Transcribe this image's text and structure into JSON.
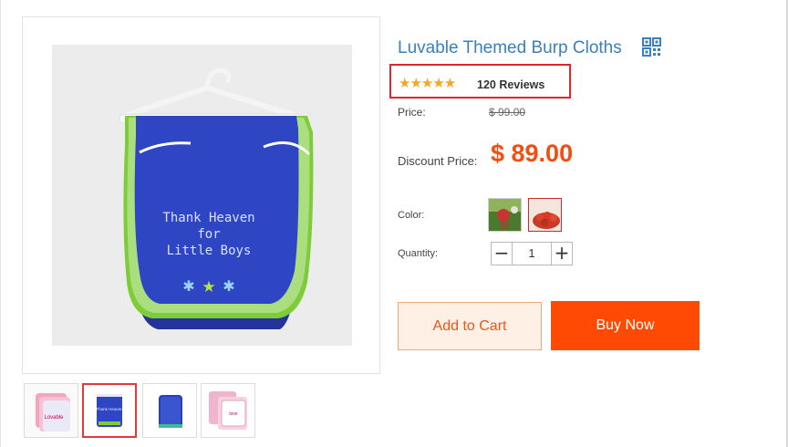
{
  "product": {
    "title": "Luvable Themed Burp Cloths",
    "qr_icon": "qr-code-icon",
    "rating": {
      "stars": "★★★★★",
      "star_count": 5,
      "reviews_label": "120 Reviews"
    },
    "price_label": "Price:",
    "price_original": "$ 99.00",
    "discount_label": "Discount Price:",
    "discount_price": "$ 89.00",
    "color_label": "Color:",
    "quantity_label": "Quantity:",
    "quantity_value": "1",
    "minus_symbol": "−",
    "plus_symbol": "+",
    "add_to_cart_label": "Add to Cart",
    "buy_now_label": "Buy Now",
    "main_image_text": [
      "Thank Heaven",
      "for",
      "Little Boys"
    ]
  },
  "colors": {
    "title": "#3a7fc1",
    "discount": "#f34d0f",
    "buy_now": "#ff4a04",
    "highlight_border": "#e0262b",
    "star": "#f5a623"
  }
}
